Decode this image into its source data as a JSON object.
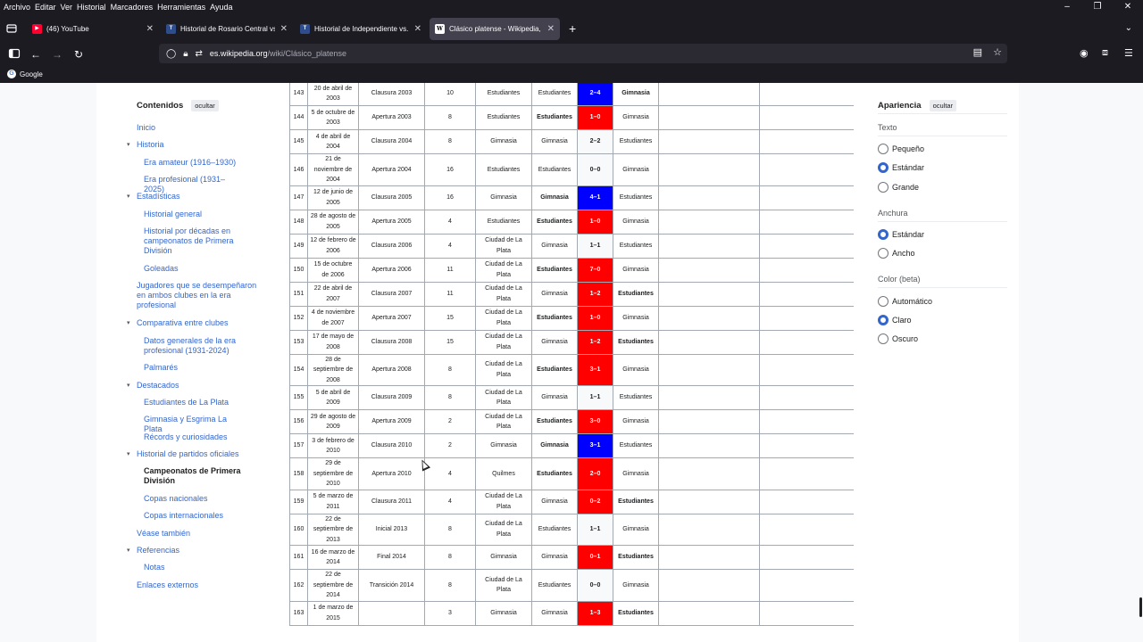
{
  "menu": [
    "Archivo",
    "Editar",
    "Ver",
    "Historial",
    "Marcadores",
    "Herramientas",
    "Ayuda"
  ],
  "tabs": [
    {
      "title": "(46) YouTube",
      "favicon": "youtube-icon",
      "active": false
    },
    {
      "title": "Historial de Rosario Central vs. N",
      "favicon": "tyc-icon",
      "active": false
    },
    {
      "title": "Historial de Independiente vs. R",
      "favicon": "tyc-icon",
      "active": false
    },
    {
      "title": "Clásico platense - Wikipedia, la",
      "favicon": "wikipedia-icon",
      "active": true
    }
  ],
  "url": {
    "host": "es.wikipedia.org",
    "path": "/wiki/Clásico_platense"
  },
  "bookmarks": [
    {
      "label": "Google"
    }
  ],
  "toc": {
    "title": "Contenidos",
    "hide_label": "ocultar",
    "items": [
      {
        "label": "Inicio",
        "level": 1,
        "caret": false
      },
      {
        "label": "Historia",
        "level": 1,
        "caret": true
      },
      {
        "label": "Era amateur (1916–1930)",
        "level": 2
      },
      {
        "label": "Era profesional (1931–2025)",
        "level": 2
      },
      {
        "label": "Estadísticas",
        "level": 1,
        "caret": true
      },
      {
        "label": "Historial general",
        "level": 2
      },
      {
        "label": "Historial por décadas en campeonatos de Primera División",
        "level": 2
      },
      {
        "label": "Goleadas",
        "level": 2
      },
      {
        "label": "Jugadores que se desempeñaron en ambos clubes en la era profesional",
        "level": 1,
        "caret": false
      },
      {
        "label": "Comparativa entre clubes",
        "level": 1,
        "caret": true
      },
      {
        "label": "Datos generales de la era profesional (1931-2024)",
        "level": 2
      },
      {
        "label": "Palmarés",
        "level": 2
      },
      {
        "label": "Destacados",
        "level": 1,
        "caret": true
      },
      {
        "label": "Estudiantes de La Plata",
        "level": 2
      },
      {
        "label": "Gimnasia y Esgrima La Plata",
        "level": 2
      },
      {
        "label": "Récords y curiosidades",
        "level": 2
      },
      {
        "label": "Historial de partidos oficiales",
        "level": 1,
        "caret": true
      },
      {
        "label": "Campeonatos de Primera División",
        "level": 2,
        "bold": true
      },
      {
        "label": "Copas nacionales",
        "level": 2
      },
      {
        "label": "Copas internacionales",
        "level": 2
      },
      {
        "label": "Véase también",
        "level": 1,
        "caret": false
      },
      {
        "label": "Referencias",
        "level": 1,
        "caret": true
      },
      {
        "label": "Notas",
        "level": 2
      },
      {
        "label": "Enlaces externos",
        "level": 1,
        "caret": false
      }
    ]
  },
  "matches": [
    {
      "n": "143",
      "date": "20 de abril de 2003",
      "tournament": "Clausura 2003",
      "round": "10",
      "stadium": "Estudiantes",
      "home": "Estudiantes",
      "home_bold": false,
      "result": "2–4",
      "color": "blue",
      "away": "Gimnasia",
      "away_bold": true
    },
    {
      "n": "144",
      "date": "5 de octubre de 2003",
      "tournament": "Apertura 2003",
      "round": "8",
      "stadium": "Estudiantes",
      "home": "Estudiantes",
      "home_bold": true,
      "result": "1–0",
      "color": "red",
      "away": "Gimnasia",
      "away_bold": false
    },
    {
      "n": "145",
      "date": "4 de abril de 2004",
      "tournament": "Clausura 2004",
      "round": "8",
      "stadium": "Gimnasia",
      "home": "Gimnasia",
      "home_bold": false,
      "result": "2–2",
      "color": "none",
      "away": "Estudiantes",
      "away_bold": false
    },
    {
      "n": "146",
      "date": "21 de noviembre de 2004",
      "tournament": "Apertura 2004",
      "round": "16",
      "stadium": "Estudiantes",
      "home": "Estudiantes",
      "home_bold": false,
      "result": "0–0",
      "color": "none",
      "away": "Gimnasia",
      "away_bold": false
    },
    {
      "n": "147",
      "date": "12 de junio de 2005",
      "tournament": "Clausura 2005",
      "round": "16",
      "stadium": "Gimnasia",
      "home": "Gimnasia",
      "home_bold": true,
      "result": "4–1",
      "color": "blue",
      "away": "Estudiantes",
      "away_bold": false
    },
    {
      "n": "148",
      "date": "28 de agosto de 2005",
      "tournament": "Apertura 2005",
      "round": "4",
      "stadium": "Estudiantes",
      "home": "Estudiantes",
      "home_bold": true,
      "result": "1–0",
      "color": "red",
      "away": "Gimnasia",
      "away_bold": false
    },
    {
      "n": "149",
      "date": "12 de febrero de 2006",
      "tournament": "Clausura 2006",
      "round": "4",
      "stadium": "Ciudad de La Plata",
      "home": "Gimnasia",
      "home_bold": false,
      "result": "1–1",
      "color": "none",
      "away": "Estudiantes",
      "away_bold": false
    },
    {
      "n": "150",
      "date": "15 de octubre de 2006",
      "tournament": "Apertura 2006",
      "round": "11",
      "stadium": "Ciudad de La Plata",
      "home": "Estudiantes",
      "home_bold": true,
      "result": "7–0",
      "color": "red",
      "away": "Gimnasia",
      "away_bold": false
    },
    {
      "n": "151",
      "date": "22 de abril de 2007",
      "tournament": "Clausura 2007",
      "round": "11",
      "stadium": "Ciudad de La Plata",
      "home": "Gimnasia",
      "home_bold": false,
      "result": "1–2",
      "color": "red",
      "away": "Estudiantes",
      "away_bold": true
    },
    {
      "n": "152",
      "date": "4 de noviembre de 2007",
      "tournament": "Apertura 2007",
      "round": "15",
      "stadium": "Ciudad de La Plata",
      "home": "Estudiantes",
      "home_bold": true,
      "result": "1–0",
      "color": "red",
      "away": "Gimnasia",
      "away_bold": false
    },
    {
      "n": "153",
      "date": "17 de mayo de 2008",
      "tournament": "Clausura 2008",
      "round": "15",
      "stadium": "Ciudad de La Plata",
      "home": "Gimnasia",
      "home_bold": false,
      "result": "1–2",
      "color": "red",
      "away": "Estudiantes",
      "away_bold": true
    },
    {
      "n": "154",
      "date": "28 de septiembre de 2008",
      "tournament": "Apertura 2008",
      "round": "8",
      "stadium": "Ciudad de La Plata",
      "home": "Estudiantes",
      "home_bold": true,
      "result": "3–1",
      "color": "red",
      "away": "Gimnasia",
      "away_bold": false
    },
    {
      "n": "155",
      "date": "5 de abril de 2009",
      "tournament": "Clausura 2009",
      "round": "8",
      "stadium": "Ciudad de La Plata",
      "home": "Gimnasia",
      "home_bold": false,
      "result": "1–1",
      "color": "none",
      "away": "Estudiantes",
      "away_bold": false
    },
    {
      "n": "156",
      "date": "29 de agosto de 2009",
      "tournament": "Apertura 2009",
      "round": "2",
      "stadium": "Ciudad de La Plata",
      "home": "Estudiantes",
      "home_bold": true,
      "result": "3–0",
      "color": "red",
      "away": "Gimnasia",
      "away_bold": false
    },
    {
      "n": "157",
      "date": "3 de febrero de 2010",
      "tournament": "Clausura 2010",
      "round": "2",
      "stadium": "Gimnasia",
      "home": "Gimnasia",
      "home_bold": true,
      "result": "3–1",
      "color": "blue",
      "away": "Estudiantes",
      "away_bold": false
    },
    {
      "n": "158",
      "date": "29 de septiembre de 2010",
      "tournament": "Apertura 2010",
      "round": "4",
      "stadium": "Quilmes",
      "home": "Estudiantes",
      "home_bold": true,
      "result": "2–0",
      "color": "red",
      "away": "Gimnasia",
      "away_bold": false
    },
    {
      "n": "159",
      "date": "5 de marzo de 2011",
      "tournament": "Clausura 2011",
      "round": "4",
      "stadium": "Ciudad de La Plata",
      "home": "Gimnasia",
      "home_bold": false,
      "result": "0–2",
      "color": "red",
      "away": "Estudiantes",
      "away_bold": true
    },
    {
      "n": "160",
      "date": "22 de septiembre de 2013",
      "tournament": "Inicial 2013",
      "round": "8",
      "stadium": "Ciudad de La Plata",
      "home": "Estudiantes",
      "home_bold": false,
      "result": "1–1",
      "color": "none",
      "away": "Gimnasia",
      "away_bold": false
    },
    {
      "n": "161",
      "date": "16 de marzo de 2014",
      "tournament": "Final 2014",
      "round": "8",
      "stadium": "Gimnasia",
      "home": "Gimnasia",
      "home_bold": false,
      "result": "0–1",
      "color": "red",
      "away": "Estudiantes",
      "away_bold": true
    },
    {
      "n": "162",
      "date": "22 de septiembre de 2014",
      "tournament": "Transición 2014",
      "round": "8",
      "stadium": "Ciudad de La Plata",
      "home": "Estudiantes",
      "home_bold": false,
      "result": "0–0",
      "color": "none",
      "away": "Gimnasia",
      "away_bold": false
    },
    {
      "n": "163",
      "date": "1 de marzo de 2015",
      "tournament": "",
      "round": "3",
      "stadium": "Gimnasia",
      "home": "Gimnasia",
      "home_bold": false,
      "result": "1–3",
      "color": "red",
      "away": "Estudiantes",
      "away_bold": true
    }
  ],
  "appearance": {
    "title": "Apariencia",
    "hide_label": "ocultar",
    "text_label": "Texto",
    "text_options": [
      {
        "label": "Pequeño",
        "selected": false
      },
      {
        "label": "Estándar",
        "selected": true
      },
      {
        "label": "Grande",
        "selected": false
      }
    ],
    "width_label": "Anchura",
    "width_options": [
      {
        "label": "Estándar",
        "selected": true
      },
      {
        "label": "Ancho",
        "selected": false
      }
    ],
    "color_label": "Color (beta)",
    "color_options": [
      {
        "label": "Automático",
        "selected": false
      },
      {
        "label": "Claro",
        "selected": true
      },
      {
        "label": "Oscuro",
        "selected": false
      }
    ]
  },
  "colors": {
    "home_win": "#ff0000",
    "away_win": "#0000ff",
    "link": "#3366cc"
  }
}
